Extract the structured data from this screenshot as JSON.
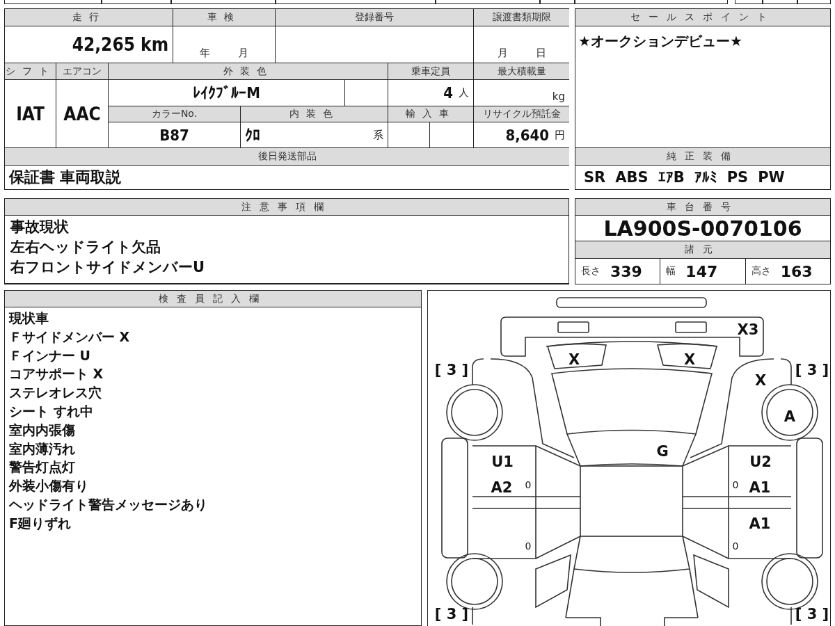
{
  "vehicle_table": {
    "cells": [
      {
        "kind": "header",
        "text": "走行"
      },
      {
        "kind": "header",
        "text": "車検"
      },
      {
        "kind": "header",
        "text": "登録番号"
      },
      {
        "kind": "header",
        "text": "譲渡書類期限"
      },
      {
        "kind": "value",
        "text": "42,265 km"
      },
      {
        "kind": "value",
        "units": [
          "年",
          "月"
        ]
      },
      {
        "kind": "value"
      },
      {
        "kind": "value",
        "units": [
          "月",
          "日"
        ]
      },
      {
        "kind": "header",
        "text": "シフト"
      },
      {
        "kind": "header",
        "text": "エアコン"
      },
      {
        "kind": "header",
        "text": "外装色"
      },
      {
        "kind": "header",
        "text": "乗車定員"
      },
      {
        "kind": "header",
        "text": "最大積載量"
      },
      {
        "kind": "value",
        "text": "IAT"
      },
      {
        "kind": "value",
        "text": "AAC"
      },
      {
        "kind": "value",
        "text": "ﾚｲｸﾌﾞﾙｰM"
      },
      {
        "kind": "value"
      },
      {
        "kind": "value",
        "text": "4",
        "units": [
          "人"
        ]
      },
      {
        "kind": "value",
        "units": [
          "kg"
        ]
      },
      {
        "kind": "header",
        "text": "カラーNo."
      },
      {
        "kind": "header",
        "text": "内装色"
      },
      {
        "kind": "header",
        "text": "輸入車"
      },
      {
        "kind": "header",
        "text": "リサイクル預託金"
      },
      {
        "kind": "value",
        "text": "B87"
      },
      {
        "kind": "value",
        "text": "ｸﾛ",
        "units": [
          "系"
        ]
      },
      {
        "kind": "value"
      },
      {
        "kind": "value"
      },
      {
        "kind": "value",
        "text": "8,640",
        "units": [
          "円"
        ]
      },
      {
        "kind": "header",
        "text": "後日発送部品"
      },
      {
        "kind": "value",
        "text": "保証書 車両取説"
      }
    ]
  },
  "sales_point": {
    "title": "セールスポイント",
    "text": "★オークションデビュー★"
  },
  "equipment": {
    "title": "純正装備",
    "items": [
      "SR",
      "ABS",
      "ｴｱB",
      "ｱﾙﾐ",
      "PS",
      "PW"
    ]
  },
  "notes": {
    "title": "注意事項欄",
    "lines": [
      "事故現状",
      "左右ヘッドライト欠品",
      "右フロントサイドメンバーU"
    ]
  },
  "chassis": {
    "title": "車台番号",
    "number": "LA900S-0070106"
  },
  "specs": {
    "title": "諸元",
    "items": [
      {
        "label": "長さ",
        "value": "339"
      },
      {
        "label": "幅",
        "value": "147"
      },
      {
        "label": "高さ",
        "value": "163"
      }
    ]
  },
  "inspector": {
    "title": "検査員記入欄",
    "lines": [
      "現状車",
      "Ｆサイドメンバー X",
      "Ｆインナー U",
      "コアサポート X",
      "ステレオレス穴",
      "シート すれ中",
      "室内内張傷",
      "室内薄汚れ",
      "警告灯点灯",
      "外装小傷有り",
      "ヘッドライト警告メッセージあり",
      "F廻りずれ"
    ]
  },
  "diagram": {
    "marks": [
      "X3",
      "X",
      "X",
      "[ 3 ]",
      "[ 3 ]",
      "X",
      "A",
      "G",
      "U1",
      "U2",
      "A2",
      "0",
      "0",
      "A1",
      "A1",
      "0",
      "0",
      "[ 3 ]",
      "[ 3 ]"
    ]
  }
}
